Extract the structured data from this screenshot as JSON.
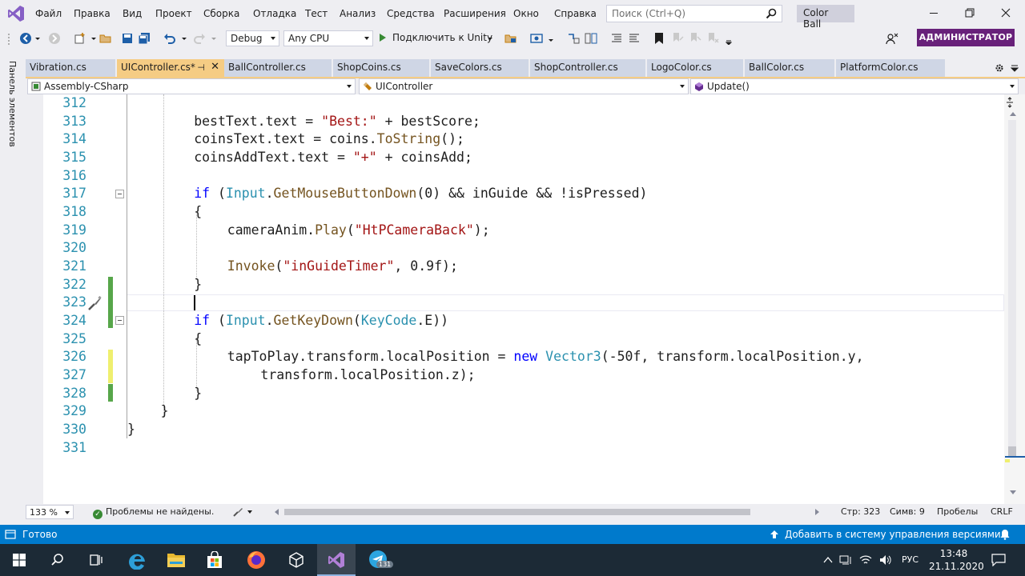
{
  "menu": {
    "items": [
      "Файл",
      "Правка",
      "Вид",
      "Проект",
      "Сборка",
      "Отладка",
      "Тест",
      "Анализ",
      "Средства",
      "Расширения",
      "Окно",
      "Справка"
    ],
    "search_placeholder": "Поиск (Ctrl+Q)",
    "solution_name": "Color Ball"
  },
  "toolbar": {
    "config": "Debug",
    "platform": "Any CPU",
    "attach_label": "Подключить к Unity",
    "admin_label": "АДМИНИСТРАТОР"
  },
  "left_panel": {
    "label": "Панель элементов"
  },
  "tabs": [
    {
      "label": "Vibration.cs",
      "active": false
    },
    {
      "label": "UIController.cs*",
      "active": true
    },
    {
      "label": "BallController.cs",
      "active": false
    },
    {
      "label": "ShopCoins.cs",
      "active": false
    },
    {
      "label": "SaveColors.cs",
      "active": false
    },
    {
      "label": "ShopController.cs",
      "active": false
    },
    {
      "label": "LogoColor.cs",
      "active": false
    },
    {
      "label": "BallColor.cs",
      "active": false
    },
    {
      "label": "PlatformColor.cs",
      "active": false
    }
  ],
  "tab_pin_glyph": "⊣",
  "tab_close_glyph": "✕",
  "navbar": {
    "project": "Assembly-CSharp",
    "class": "UIController",
    "member": "Update()"
  },
  "editor": {
    "line_numbers": [
      "312",
      "313",
      "314",
      "315",
      "316",
      "317",
      "318",
      "319",
      "320",
      "321",
      "322",
      "323",
      "324",
      "325",
      "326",
      "327",
      "328",
      "329",
      "330",
      "331"
    ]
  },
  "editor_status": {
    "zoom": "133 %",
    "problems": "Проблемы не найдены.",
    "line": "Стр: 323",
    "char": "Симв: 9",
    "spaces": "Пробелы",
    "eol": "CRLF"
  },
  "statusbar": {
    "ready": "Готово",
    "source_control": "Добавить в систему управления версиями"
  },
  "taskbar": {
    "lang": "РУС",
    "time": "13:48",
    "date": "21.11.2020",
    "telegram_badge": "131"
  },
  "colors": {
    "accent": "#68217a",
    "status_blue": "#007acc",
    "active_tab": "#f5cc84",
    "inactive_tab": "#cfd6e5",
    "line_number": "#2b91af",
    "change_saved": "#57a64a",
    "change_unsaved": "#efef6f"
  }
}
